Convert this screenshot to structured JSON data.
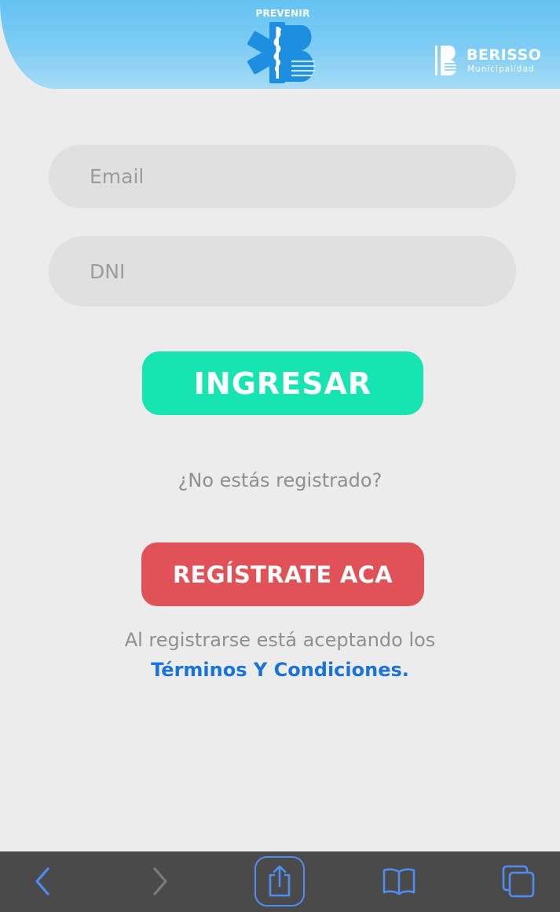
{
  "header": {
    "app_logo_title": "PREVENIR",
    "brand_name": "BERISSO",
    "brand_subtitle": "Municipalidad"
  },
  "form": {
    "email": {
      "placeholder": "Email",
      "value": ""
    },
    "dni": {
      "placeholder": "DNI",
      "value": ""
    },
    "login_label": "INGRESAR",
    "not_registered_text": "¿No estás registrado?",
    "register_label": "REGÍSTRATE ACA",
    "terms_notice": "Al registrarse está aceptando los",
    "terms_link": "Términos Y Condiciones."
  },
  "colors": {
    "header": "#63c3f2",
    "background": "#ececec",
    "login_button": "#17e5b1",
    "register_button": "#e05257",
    "link": "#1a73d9",
    "toolbar": "#4a4a4a",
    "toolbar_icon": "#4f8df2"
  },
  "toolbar": {
    "icons": [
      "back-icon",
      "forward-icon",
      "share-icon",
      "bookmarks-icon",
      "tabs-icon"
    ]
  }
}
